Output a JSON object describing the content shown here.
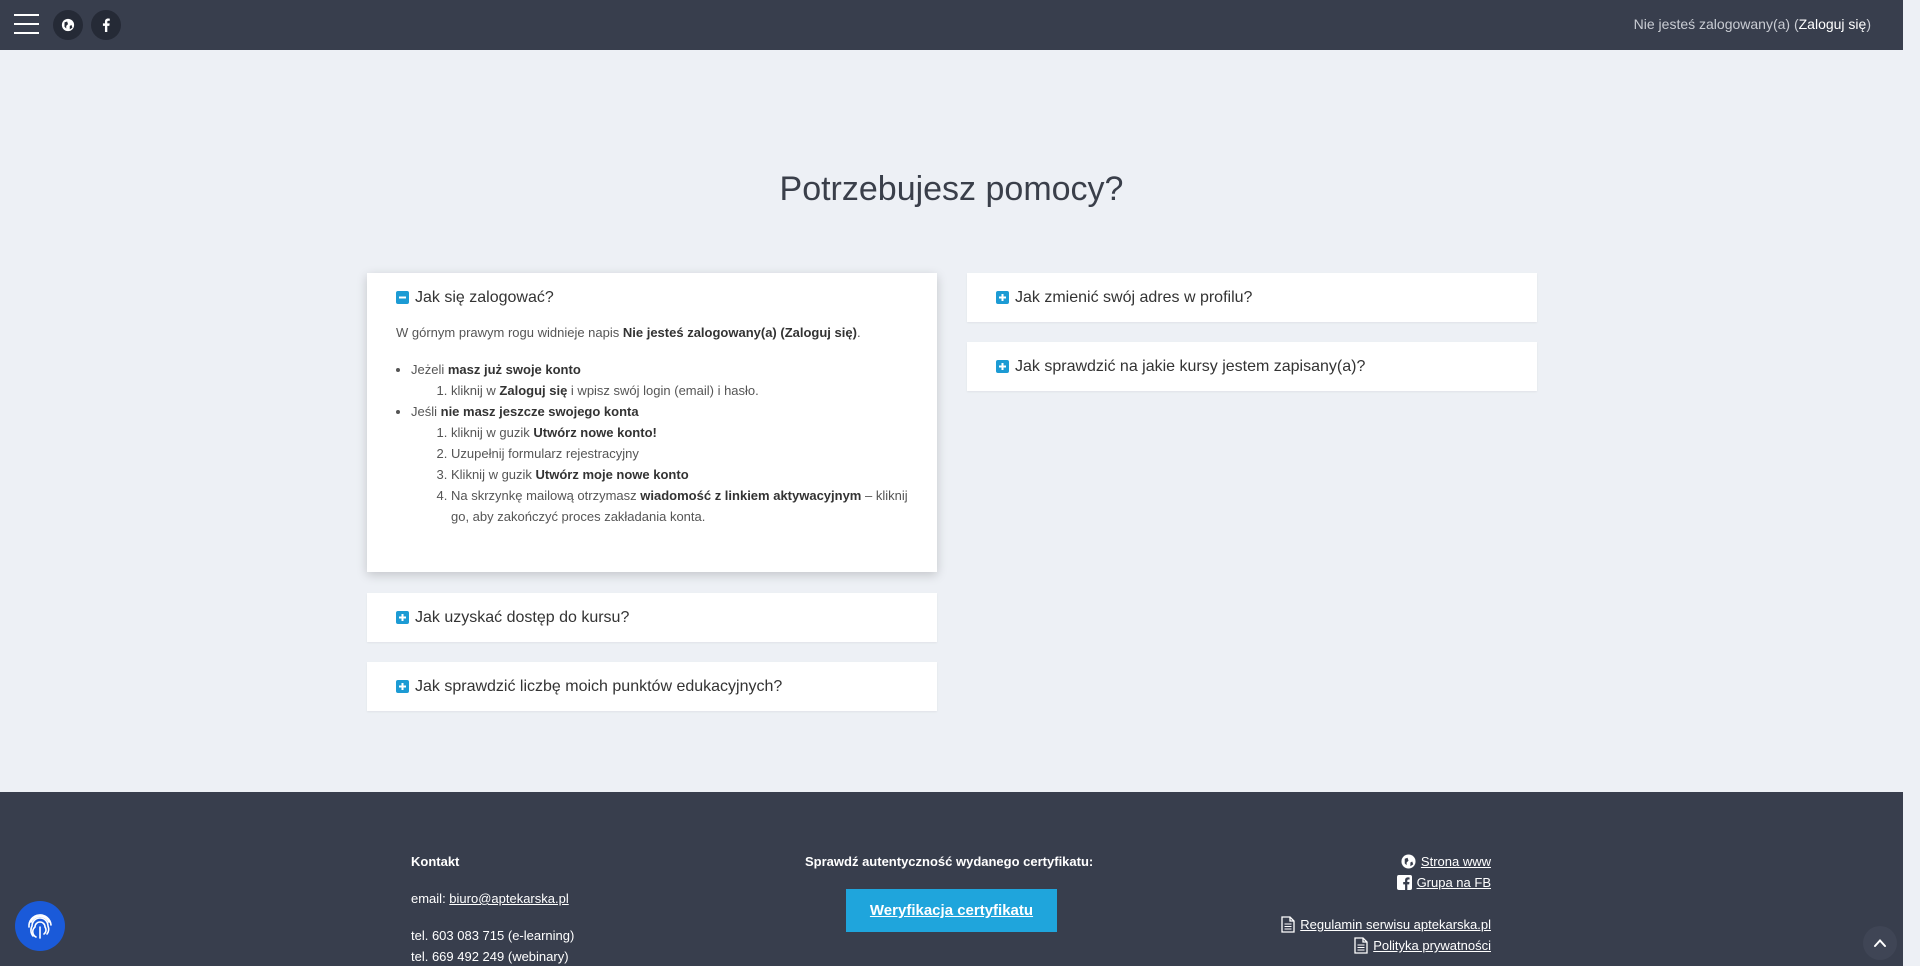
{
  "header": {
    "login_prefix": "Nie jesteś zalogowany(a) (",
    "login_link": "Zaloguj się",
    "login_suffix": ")"
  },
  "page": {
    "title": "Potrzebujesz pomocy?"
  },
  "faq": {
    "login": {
      "question": "Jak się zalogować?",
      "intro_pre": "W górnym prawym rogu widnieje napis ",
      "intro_bold": "Nie jesteś zalogowany(a) (Zaloguj się)",
      "intro_post": ".",
      "have_account_pre": "Jeżeli ",
      "have_account_bold": "masz już swoje konto",
      "have_step1_pre": "kliknij w ",
      "have_step1_bold": "Zaloguj się",
      "have_step1_post": " i wpisz swój login (email) i hasło.",
      "no_account_pre": "Jeśli ",
      "no_account_bold": "nie masz jeszcze swojego konta",
      "no_step1_pre": "kliknij w guzik ",
      "no_step1_bold": "Utwórz nowe konto!",
      "no_step2": "Uzupełnij formularz rejestracyjny",
      "no_step3_pre": "Kliknij w guzik ",
      "no_step3_bold": "Utwórz moje nowe konto",
      "no_step4_pre": "Na skrzynkę mailową otrzymasz ",
      "no_step4_bold": "wiadomość z linkiem aktywacyjnym",
      "no_step4_post": " – kliknij go, aby zakończyć proces zakładania konta."
    },
    "course_access": {
      "question": "Jak uzyskać dostęp do kursu?"
    },
    "points": {
      "question": "Jak sprawdzić liczbę moich punktów edukacyjnych?"
    },
    "change_address": {
      "question": "Jak zmienić swój adres w profilu?"
    },
    "enrolled_courses": {
      "question": "Jak sprawdzić na jakie kursy jestem zapisany(a)?"
    }
  },
  "footer": {
    "contact_heading": "Kontakt",
    "email_label": "email: ",
    "email": "biuro@aptekarska.pl",
    "phone1": "tel. 603 083 715 (e-learning)",
    "phone2": "tel. 669 492 249 (webinary)",
    "cert_heading": "Sprawdź autentyczność wydanego certyfikatu:",
    "cert_button": "Weryfikacja certyfikatu",
    "link_www": "Strona www",
    "link_fb": "Grupa na FB",
    "link_terms": "Regulamin serwisu aptekarska.pl",
    "link_privacy": "Polityka prywatności"
  },
  "colors": {
    "topbar": "#383e4d",
    "accent": "#1fa5dc",
    "background": "#edf0f5",
    "fab": "#1a5ad9"
  },
  "icons": {
    "menu": "hamburger-icon",
    "globe": "globe-icon",
    "facebook": "facebook-icon",
    "expand": "plus-square-icon",
    "collapse": "minus-square-icon",
    "document": "document-icon",
    "fingerprint": "fingerprint-icon",
    "scroll_top": "chevron-up-icon"
  }
}
